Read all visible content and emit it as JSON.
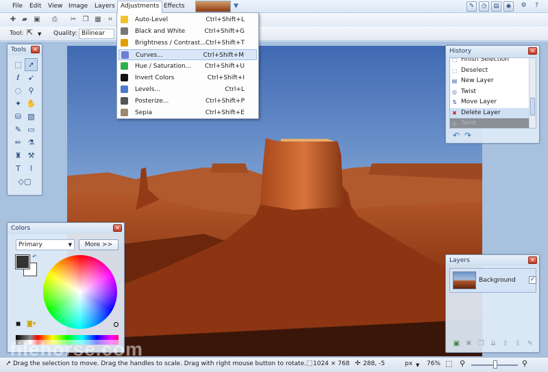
{
  "menubar": {
    "items": [
      "File",
      "Edit",
      "View",
      "Image",
      "Layers",
      "Adjustments",
      "Effects"
    ],
    "active": "Adjustments"
  },
  "toolbar2": {
    "tool_label": "Tool:",
    "quality_label": "Quality:",
    "quality_value": "Bilinear"
  },
  "adjustments_menu": [
    {
      "label": "Auto-Level",
      "shortcut": "Ctrl+Shift+L",
      "icon": "auto-level-icon",
      "color": "#f2c230"
    },
    {
      "label": "Black and White",
      "shortcut": "Ctrl+Shift+G",
      "icon": "black-and-white-icon",
      "color": "#777777"
    },
    {
      "label": "Brightness / Contrast...",
      "shortcut": "Ctrl+Shift+T",
      "icon": "brightness-icon",
      "color": "#e0a000"
    },
    {
      "label": "Curves...",
      "shortcut": "Ctrl+Shift+M",
      "icon": "curves-icon",
      "color": "#6b7fd6"
    },
    {
      "label": "Hue / Saturation...",
      "shortcut": "Ctrl+Shift+U",
      "icon": "hue-saturation-icon",
      "color": "#2fb04a"
    },
    {
      "label": "Invert Colors",
      "shortcut": "Ctrl+Shift+I",
      "icon": "invert-colors-icon",
      "color": "#111111"
    },
    {
      "label": "Levels...",
      "shortcut": "Ctrl+L",
      "icon": "levels-icon",
      "color": "#4a7cc9"
    },
    {
      "label": "Posterize...",
      "shortcut": "Ctrl+Shift+P",
      "icon": "posterize-icon",
      "color": "#555555"
    },
    {
      "label": "Sepia",
      "shortcut": "Ctrl+Shift+E",
      "icon": "sepia-icon",
      "color": "#9b8a70"
    }
  ],
  "tools": {
    "title": "Tools"
  },
  "colors": {
    "title": "Colors",
    "mode": "Primary",
    "more_button": "More >>",
    "primary": "#333333",
    "secondary": "#ffffff"
  },
  "history": {
    "title": "History",
    "items": [
      {
        "label": "Finish Selection",
        "icon": "finish-selection-icon",
        "state": "normal"
      },
      {
        "label": "Deselect",
        "icon": "deselect-icon",
        "state": "normal"
      },
      {
        "label": "New Layer",
        "icon": "new-layer-icon",
        "state": "normal"
      },
      {
        "label": "Twist",
        "icon": "twist-icon",
        "state": "normal"
      },
      {
        "label": "Move Layer",
        "icon": "move-layer-icon",
        "state": "normal"
      },
      {
        "label": "Delete Layer",
        "icon": "delete-layer-icon",
        "state": "selected"
      },
      {
        "label": "Twist",
        "icon": "twist-icon",
        "state": "undone"
      }
    ]
  },
  "layers": {
    "title": "Layers",
    "items": [
      {
        "name": "Background",
        "visible": true
      }
    ]
  },
  "statusbar": {
    "hint": "Drag the selection to move. Drag the handles to scale. Drag with right mouse button to rotate.",
    "image_size": "1024 × 768",
    "cursor_pos": "288, -5",
    "units": "px",
    "zoom": "76%"
  },
  "watermark": "filehorse.com"
}
